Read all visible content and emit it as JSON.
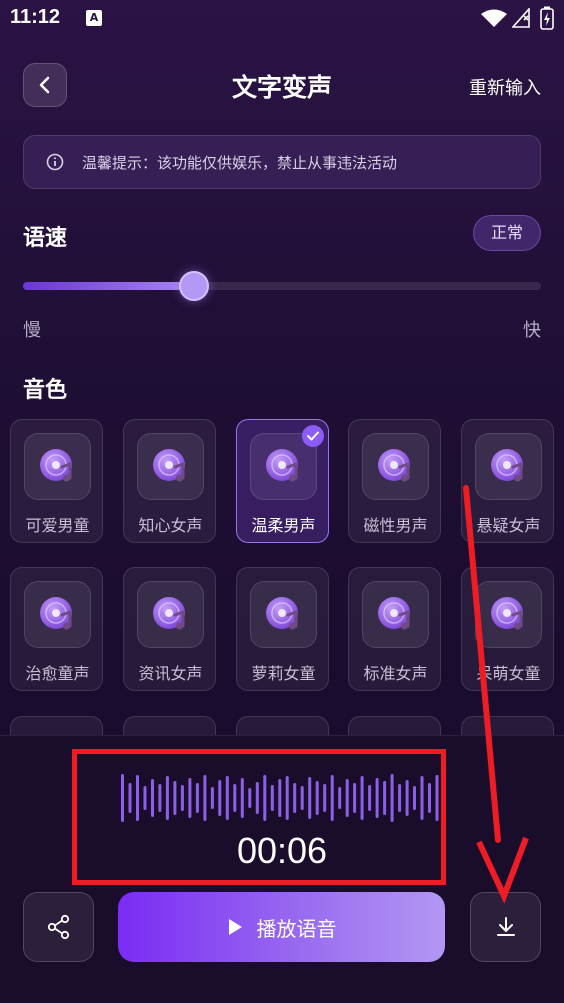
{
  "status_bar": {
    "time": "11:12",
    "notif_letter": "A"
  },
  "header": {
    "title": "文字变声",
    "action_label": "重新输入"
  },
  "notice": {
    "text": "温馨提示：该功能仅供娱乐，禁止从事违法活动"
  },
  "speed": {
    "label": "语速",
    "badge": "正常",
    "min_label": "慢",
    "max_label": "快",
    "value_fraction": 0.33
  },
  "voices": {
    "label": "音色",
    "items": [
      {
        "name": "可爱男童",
        "selected": false
      },
      {
        "name": "知心女声",
        "selected": false
      },
      {
        "name": "温柔男声",
        "selected": true
      },
      {
        "name": "磁性男声",
        "selected": false
      },
      {
        "name": "悬疑女声",
        "selected": false
      },
      {
        "name": "治愈童声",
        "selected": false
      },
      {
        "name": "资讯女声",
        "selected": false
      },
      {
        "name": "萝莉女童",
        "selected": false
      },
      {
        "name": "标准女声",
        "selected": false
      },
      {
        "name": "呆萌女童",
        "selected": false
      }
    ]
  },
  "player": {
    "time": "00:06",
    "play_label": "播放语音"
  },
  "colors": {
    "accent": "#8b5cf6",
    "annotation": "#ee1c25"
  }
}
